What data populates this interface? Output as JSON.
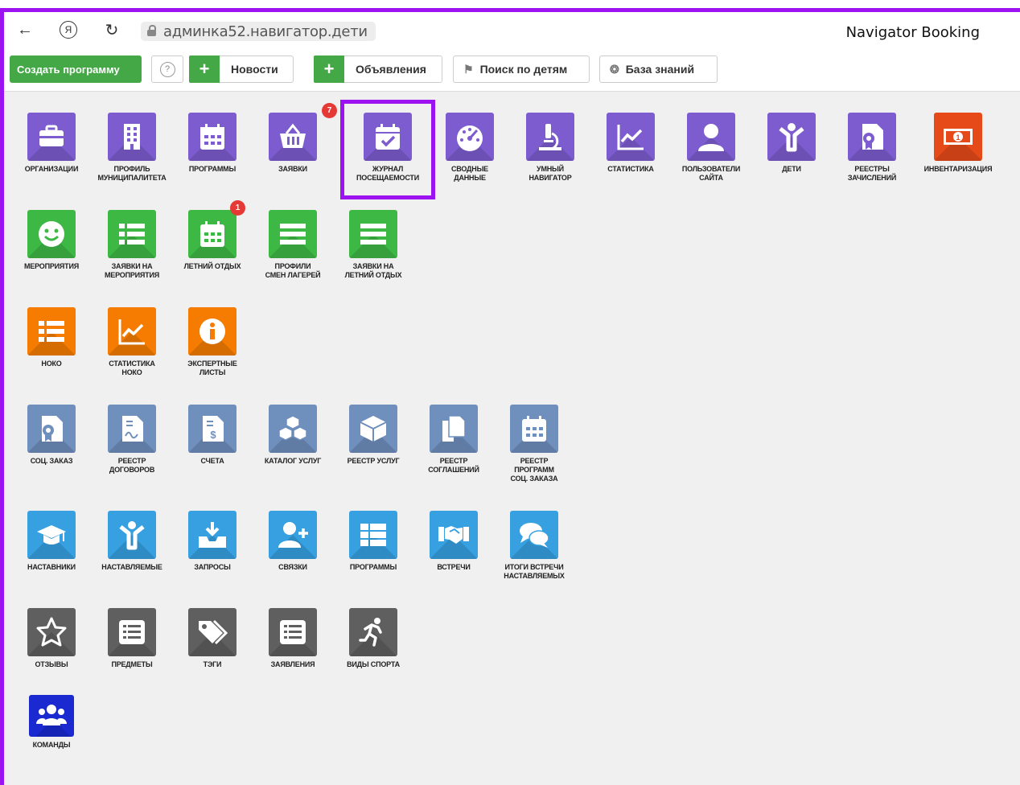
{
  "browser": {
    "url": "админка52.навигатор.дети",
    "title": "Navigator Booking"
  },
  "toolbar": {
    "create_label": "Создать программу",
    "help_icon": "?",
    "news_label": "Новости",
    "ads_label": "Объявления",
    "search_kids_label": "Поиск по детям",
    "knowledge_label": "База знаний"
  },
  "tiles": {
    "t1": "ОРГАНИЗАЦИИ",
    "t2": "ПРОФИЛЬ\nМУНИЦИПАЛИТЕТА",
    "t3": "ПРОГРАММЫ",
    "t4": "ЗАЯВКИ",
    "t5": "ЖУРНАЛ\nПОСЕЩАЕМОСТИ",
    "t6": "СВОДНЫЕ\nДАННЫЕ",
    "t7": "УМНЫЙ\nНАВИГАТОР",
    "t8": "СТАТИСТИКА",
    "t9": "ПОЛЬЗОВАТЕЛИ\nСАЙТА",
    "t10": "ДЕТИ",
    "t11": "РЕЕСТРЫ\nЗАЧИСЛЕНИЙ",
    "t12": "ИНВЕНТАРИЗАЦИЯ",
    "t13": "МЕРОПРИЯТИЯ",
    "t14": "ЗАЯВКИ НА\nМЕРОПРИЯТИЯ",
    "t15": "ЛЕТНИЙ ОТДЫХ",
    "t16": "ПРОФИЛИ\nСМЕН ЛАГЕРЕЙ",
    "t17": "ЗАЯВКИ НА\nЛЕТНИЙ ОТДЫХ",
    "t18": "НОКО",
    "t19": "СТАТИСТИКА\nНОКО",
    "t20": "ЭКСПЕРТНЫЕ\nЛИСТЫ",
    "t21": "СОЦ. ЗАКАЗ",
    "t22": "РЕЕСТР\nДОГОВОРОВ",
    "t23": "СЧЕТА",
    "t24": "КАТАЛОГ УСЛУГ",
    "t25": "РЕЕСТР УСЛУГ",
    "t26": "РЕЕСТР\nСОГЛАШЕНИЙ",
    "t27": "РЕЕСТР\nПРОГРАММ\nСОЦ. ЗАКАЗА",
    "t28": "НАСТАВНИКИ",
    "t29": "НАСТАВЛЯЕМЫЕ",
    "t30": "ЗАПРОСЫ",
    "t31": "СВЯЗКИ",
    "t32": "ПРОГРАММЫ",
    "t33": "ВСТРЕЧИ",
    "t34": "ИТОГИ ВСТРЕЧИ\nНАСТАВЛЯЕМЫХ",
    "t35": "ОТЗЫВЫ",
    "t36": "ПРЕДМЕТЫ",
    "t37": "ТЭГИ",
    "t38": "ЗАЯВЛЕНИЯ",
    "t39": "ВИДЫ СПОРТА",
    "t40": "КОМАНДЫ"
  },
  "badges": {
    "requests": "7",
    "summer": "1"
  },
  "colors": {
    "highlight": "#9d12f0",
    "purple": "#7c5ccf",
    "green": "#3db845",
    "orange": "#f57c00",
    "slate": "#6f8fbd",
    "sky": "#37a0e0",
    "dark": "#5f5f5f",
    "navy": "#1a2ad0"
  }
}
